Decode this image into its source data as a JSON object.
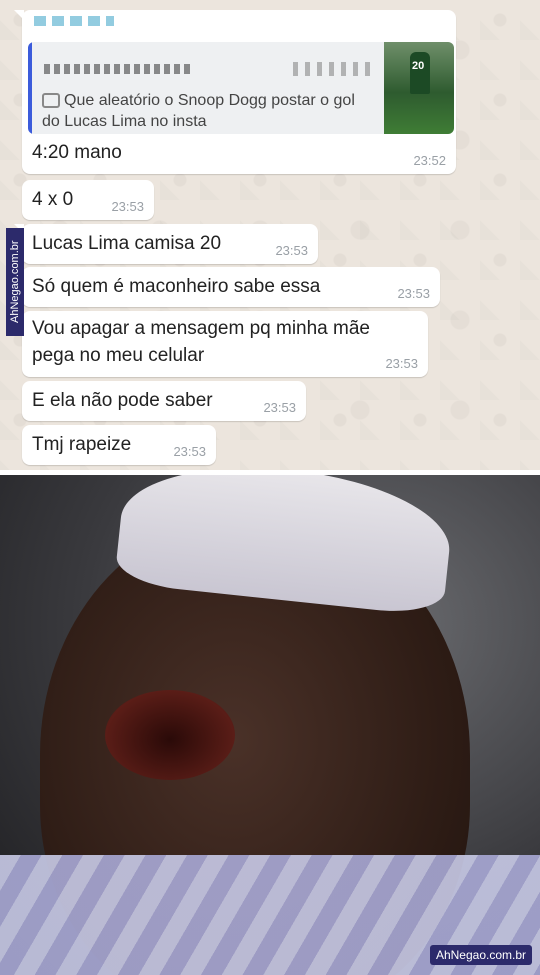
{
  "quoted": {
    "caption": "Que aleatório o Snoop Dogg postar o gol do Lucas Lima no insta",
    "thumb_number": "20"
  },
  "messages": [
    {
      "text": "4:20 mano",
      "time": "23:52"
    },
    {
      "text": "4 x 0",
      "time": "23:53"
    },
    {
      "text": "Lucas Lima camisa 20",
      "time": "23:53"
    },
    {
      "text": "Só quem é maconheiro sabe essa",
      "time": "23:53"
    },
    {
      "text_line1": "Vou apagar a mensagem pq minha mãe",
      "text_line2": "pega no meu celular",
      "time": "23:53"
    },
    {
      "text": "E ela não pode saber",
      "time": "23:53"
    },
    {
      "text": "Tmj rapeize",
      "time": "23:53"
    }
  ],
  "watermark": "AhNegao.com.br",
  "colors": {
    "chat_bg": "#ece5dd",
    "bubble": "#ffffff",
    "time": "#9aa0a6",
    "watermark_bg": "#2c2a6b"
  }
}
